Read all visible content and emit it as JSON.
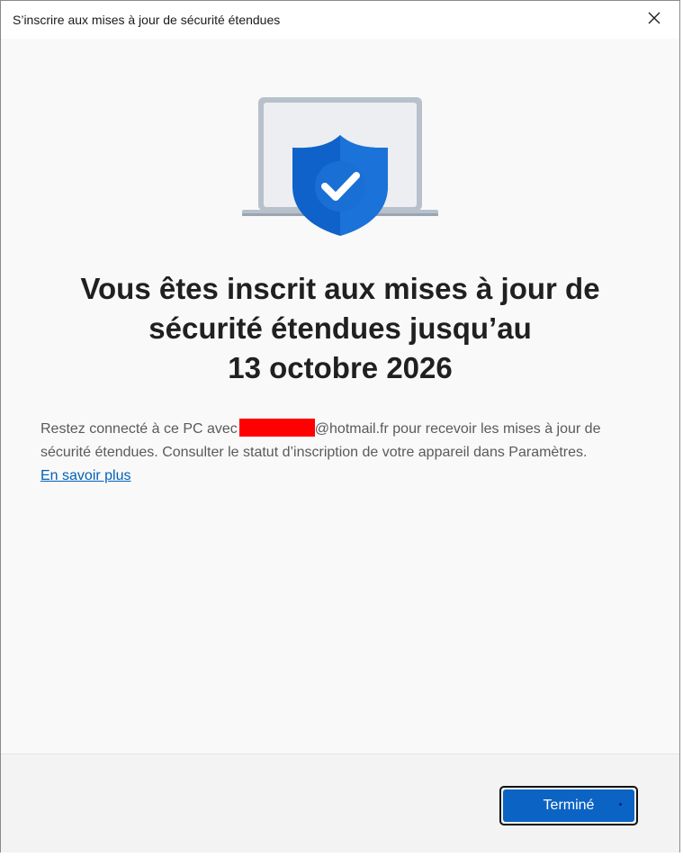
{
  "window": {
    "title": "S’inscrire aux mises à jour de sécurité étendues",
    "close_icon": "close-icon"
  },
  "hero": {
    "icon": "laptop-shield-check-icon",
    "colors": {
      "shield": "#0f62c9",
      "laptop_frame": "#b8c1cb",
      "screen": "#eceef1"
    }
  },
  "headline": {
    "line1": "Vous êtes inscrit aux mises à jour de",
    "line2": "sécurité étendues jusqu’au",
    "line3": "13 octobre 2026"
  },
  "body": {
    "prefix": "Restez connecté à ce PC avec",
    "email_suffix": "@hotmail.fr pour recevoir les mises à jour de sécurité étendues. Consulter le statut d’inscription de votre appareil dans Paramètres.",
    "learn_more": "En savoir plus"
  },
  "footer": {
    "done_label": "Terminé"
  },
  "colors": {
    "accent": "#0b63c4",
    "link": "#0060b8",
    "redaction": "#ff0000"
  }
}
